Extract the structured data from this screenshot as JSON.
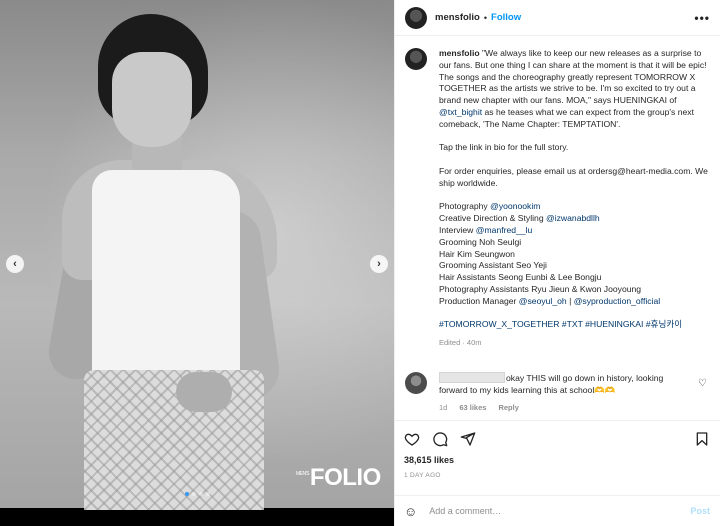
{
  "post": {
    "username": "mensfolio",
    "follow_label": "Follow",
    "more_label": "•••",
    "brand": {
      "small": "MEN'S",
      "main": "FOLIO"
    },
    "carousel": {
      "prev": "‹",
      "next": "›",
      "slides": 4,
      "active": 0
    }
  },
  "caption": {
    "username": "mensfolio",
    "p1_a": "\"We always like to keep our new releases as a surprise to our fans. But one thing I can share at the moment is that it will be epic! The songs and the choreography greatly represent TOMORROW X TOGETHER as the artists we strive to be. I'm so excited to try out a brand new chapter with our fans. MOA,\" says HUENINGKAI of ",
    "p1_link": "@txt_bighit",
    "p1_b": " as he teases what we can expect from the group's next comeback, 'The Name Chapter: TEMPTATION'.",
    "p2": "Tap the link in bio for the full story.",
    "p3": "For order enquiries, please email us at ordersg@heart-media.com. We ship worldwide.",
    "credits": [
      {
        "label": "Photography ",
        "link": "@yoonookim",
        "tail": ""
      },
      {
        "label": "Creative Direction & Styling ",
        "link": "@izwanabdllh",
        "tail": ""
      },
      {
        "label": "Interview ",
        "link": "@manfred__lu",
        "tail": ""
      },
      {
        "label": "Grooming Noh Seulgi",
        "link": "",
        "tail": ""
      },
      {
        "label": "Hair Kim Seungwon",
        "link": "",
        "tail": ""
      },
      {
        "label": "Grooming Assistant Seo Yeji",
        "link": "",
        "tail": ""
      },
      {
        "label": "Hair Assistants Seong Eunbi & Lee Bongju",
        "link": "",
        "tail": ""
      },
      {
        "label": "Photography Assistants Ryu Jieun & Kwon Jooyoung",
        "link": "",
        "tail": ""
      },
      {
        "label": "Production Manager ",
        "link": "@seoyul_oh",
        "tail": " | ",
        "link2": "@syproduction_official"
      }
    ],
    "hashtags": "#TOMORROW_X_TOGETHER #TXT #HUENINGKAI #휴닝카이",
    "meta": "Edited · 40m"
  },
  "comment": {
    "text": "okay THIS will go down in history, looking forward to my kids learning this at school🫶🫶",
    "time": "1d",
    "likes": "63 likes",
    "reply": "Reply",
    "heart": "♡"
  },
  "actions": {
    "likes": "38,615 likes",
    "ago": "1 DAY AGO"
  },
  "add_comment": {
    "emoji": "☺",
    "placeholder": "Add a comment…",
    "post_label": "Post"
  },
  "colors": {
    "link": "#00376b",
    "follow": "#0095f6",
    "post_disabled": "#b2dffc"
  }
}
